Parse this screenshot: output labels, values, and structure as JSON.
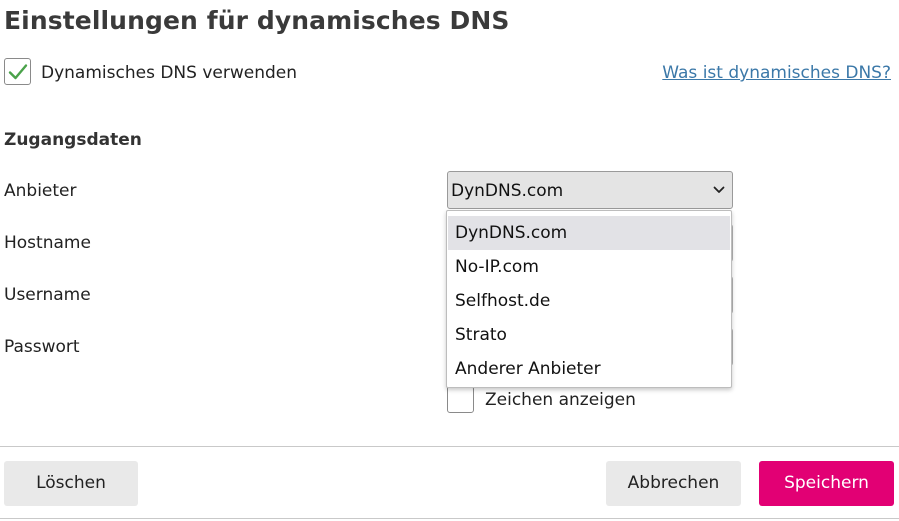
{
  "title": "Einstellungen für dynamisches DNS",
  "ddns": {
    "checked": true,
    "label": "Dynamisches DNS verwenden",
    "help_link": "Was ist dynamisches DNS?"
  },
  "section": {
    "title": "Zugangsdaten"
  },
  "fields": {
    "provider_label": "Anbieter",
    "hostname_label": "Hostname",
    "username_label": "Username",
    "password_label": "Passwort"
  },
  "provider": {
    "selected": "DynDNS.com",
    "options": [
      "DynDNS.com",
      "No-IP.com",
      "Selfhost.de",
      "Strato",
      "Anderer Anbieter"
    ],
    "highlighted_index": 0
  },
  "show_chars": {
    "checked": false,
    "label": "Zeichen anzeigen"
  },
  "buttons": {
    "delete": "Löschen",
    "cancel": "Abbrechen",
    "save": "Speichern"
  },
  "colors": {
    "accent": "#e20074",
    "link": "#3b78a8",
    "check": "#4aa24a"
  }
}
